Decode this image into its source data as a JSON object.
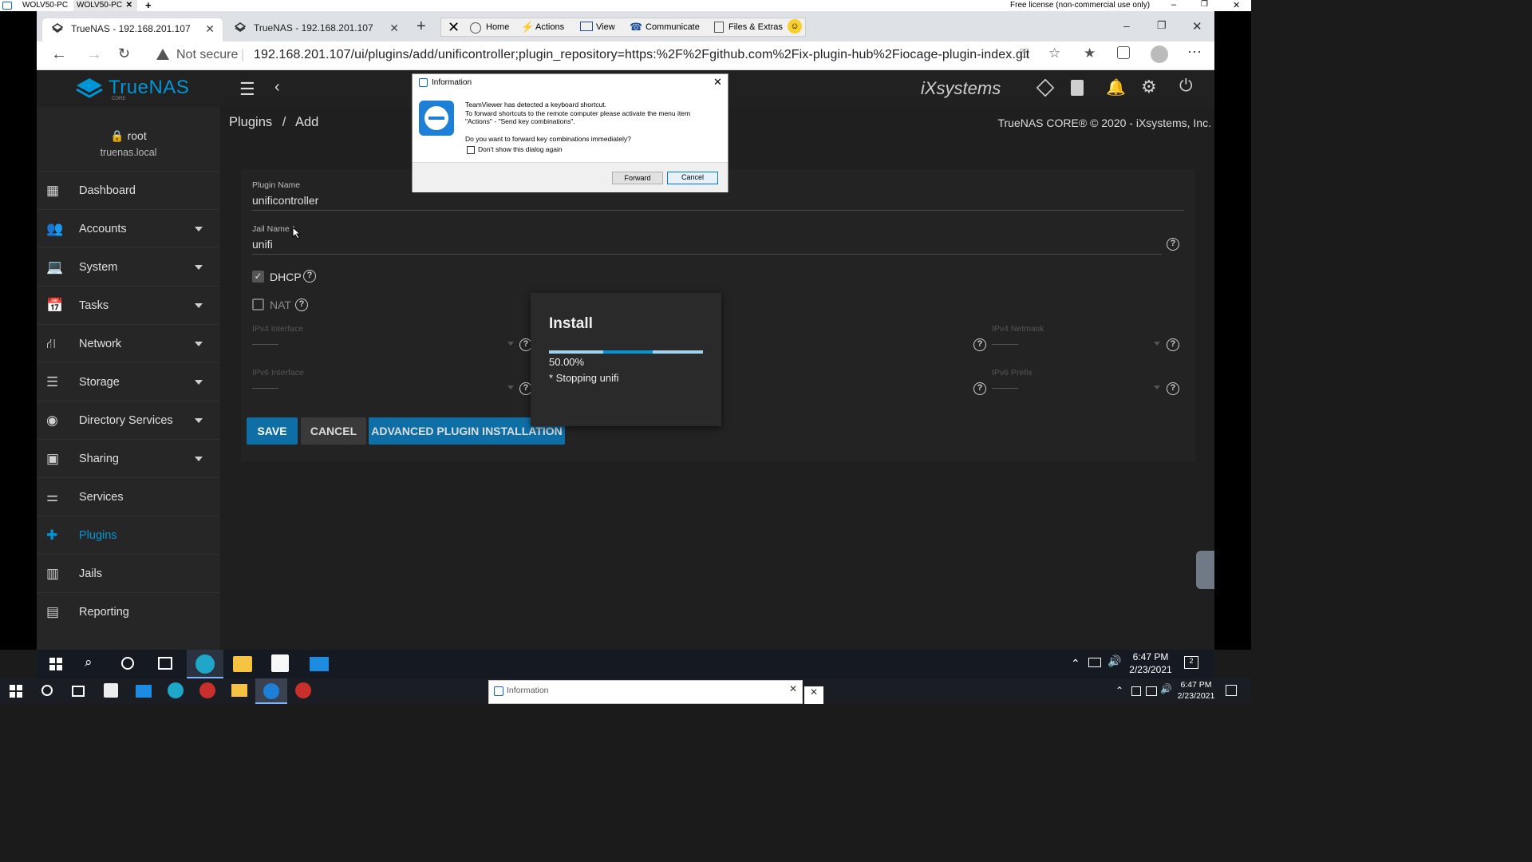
{
  "teamviewer_tabs": [
    "WOLV50-PC",
    "WOLV50-PC"
  ],
  "teamviewer_license": "Free license (non-commercial use only)",
  "teamviewer_toolbar": {
    "home": "Home",
    "actions": "Actions",
    "view": "View",
    "communicate": "Communicate",
    "files": "Files & Extras"
  },
  "browser": {
    "tabs": [
      {
        "title": "TrueNAS - 192.168.201.107"
      },
      {
        "title": "TrueNAS - 192.168.201.107"
      }
    ],
    "not_secure": "Not secure",
    "url": "192.168.201.107/ui/plugins/add/unificontroller;plugin_repository=https:%2F%2Fgithub.com%2Fix-plugin-hub%2Fiocage-plugin-index.git"
  },
  "header": {
    "logo": "TrueNAS",
    "logo_sub": "CORE",
    "brand": "iXsystems"
  },
  "user": {
    "name": "root",
    "host": "truenas.local"
  },
  "breadcrumb": {
    "section": "Plugins",
    "page": "Add"
  },
  "copyright": "TrueNAS CORE® © 2020 - iXsystems, Inc.",
  "sidebar": [
    {
      "label": "Dashboard",
      "icon": "dashboard-icon",
      "caret": false
    },
    {
      "label": "Accounts",
      "icon": "accounts-icon",
      "caret": true
    },
    {
      "label": "System",
      "icon": "laptop-icon",
      "caret": true
    },
    {
      "label": "Tasks",
      "icon": "calendar-icon",
      "caret": true
    },
    {
      "label": "Network",
      "icon": "network-icon",
      "caret": true
    },
    {
      "label": "Storage",
      "icon": "storage-icon",
      "caret": true
    },
    {
      "label": "Directory Services",
      "icon": "directory-icon",
      "caret": true
    },
    {
      "label": "Sharing",
      "icon": "sharing-icon",
      "caret": true
    },
    {
      "label": "Services",
      "icon": "sliders-icon",
      "caret": false
    },
    {
      "label": "Plugins",
      "icon": "puzzle-icon",
      "caret": false,
      "active": true
    },
    {
      "label": "Jails",
      "icon": "jail-icon",
      "caret": false
    },
    {
      "label": "Reporting",
      "icon": "chart-icon",
      "caret": false
    }
  ],
  "form": {
    "plugin_name_label": "Plugin Name",
    "plugin_name_value": "unificontroller",
    "jail_name_label": "Jail Name *",
    "jail_name_value": "unifi",
    "dhcp_label": "DHCP",
    "dhcp_checked": true,
    "nat_label": "NAT",
    "nat_checked": false,
    "ipv4_interface_label": "IPv4 interface",
    "ipv4_netmask_label": "IPv4 Netmask",
    "ipv6_interface_label": "IPv6 Interface",
    "ipv6_prefix_label": "IPv6 Prefix",
    "save": "SAVE",
    "cancel": "CANCEL",
    "advanced": "ADVANCED PLUGIN INSTALLATION"
  },
  "install_dialog": {
    "title": "Install",
    "progress": 0.5,
    "percent": "50.00%",
    "status": "* Stopping unifi"
  },
  "info_dialog": {
    "title": "Information",
    "line1": "TeamViewer has detected a keyboard shortcut.",
    "line2": "To forward shortcuts to the remote computer please activate the menu item",
    "line3": "\"Actions\" - \"Send key combinations\".",
    "question": "Do you want to forward key combinations immediately?",
    "checkbox": "Don't show this dialog again",
    "forward": "Forward",
    "cancel": "Cancel"
  },
  "remote_taskbar": {
    "time": "6:47 PM",
    "date": "2/23/2021",
    "notif": "2"
  },
  "local_taskbar": {
    "time": "6:47 PM",
    "date": "2/23/2021",
    "info_window": "Information"
  },
  "colors": {
    "accent": "#0095d5",
    "button_blue": "#0d6fa6",
    "sidebar_bg": "#262626"
  }
}
